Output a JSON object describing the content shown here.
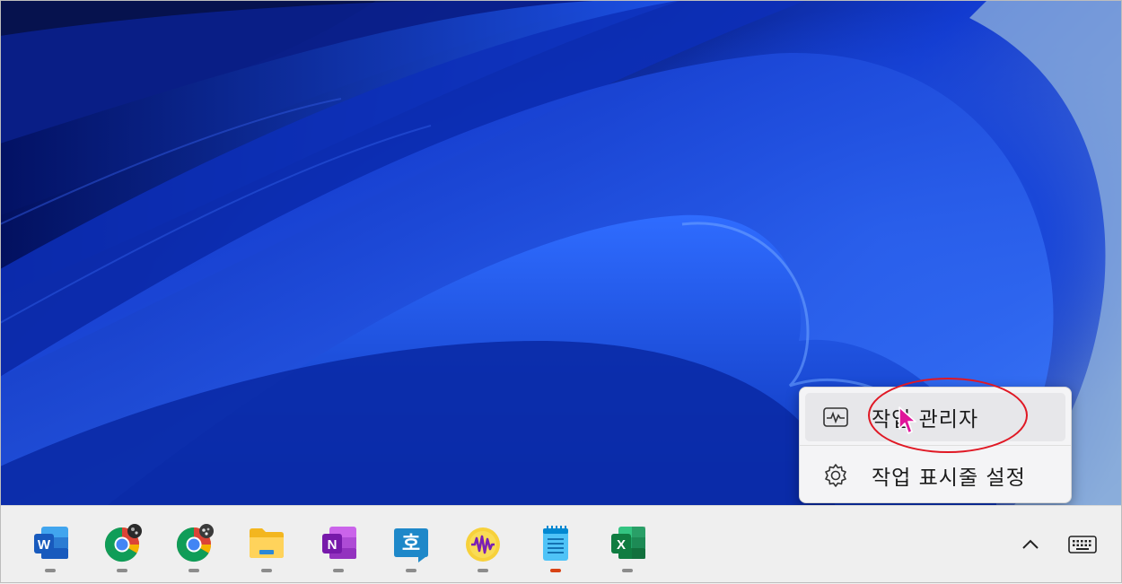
{
  "context_menu": {
    "items": [
      {
        "label": "작업 관리자",
        "icon": "task-manager-icon"
      },
      {
        "label": "작업 표시줄 설정",
        "icon": "gear-icon"
      }
    ]
  },
  "taskbar": {
    "apps": [
      {
        "name": "word",
        "icon": "word-icon",
        "letter": "W"
      },
      {
        "name": "chrome-1",
        "icon": "chrome-icon"
      },
      {
        "name": "chrome-2",
        "icon": "chrome-icon"
      },
      {
        "name": "file-explorer",
        "icon": "folder-icon"
      },
      {
        "name": "onenote",
        "icon": "onenote-icon",
        "letter": "N"
      },
      {
        "name": "hangul",
        "icon": "hangul-icon",
        "letter": "호"
      },
      {
        "name": "audio-app",
        "icon": "waveform-icon"
      },
      {
        "name": "notepad",
        "icon": "notepad-icon"
      },
      {
        "name": "excel",
        "icon": "excel-icon",
        "letter": "X"
      }
    ],
    "tray": [
      {
        "icon": "chevron-up-icon"
      },
      {
        "icon": "keyboard-icon"
      }
    ]
  },
  "colors": {
    "highlight": "#e01824",
    "cursor": "#e0169a",
    "word": "#185abd",
    "excel": "#107c41",
    "onenote": "#7719aa"
  }
}
